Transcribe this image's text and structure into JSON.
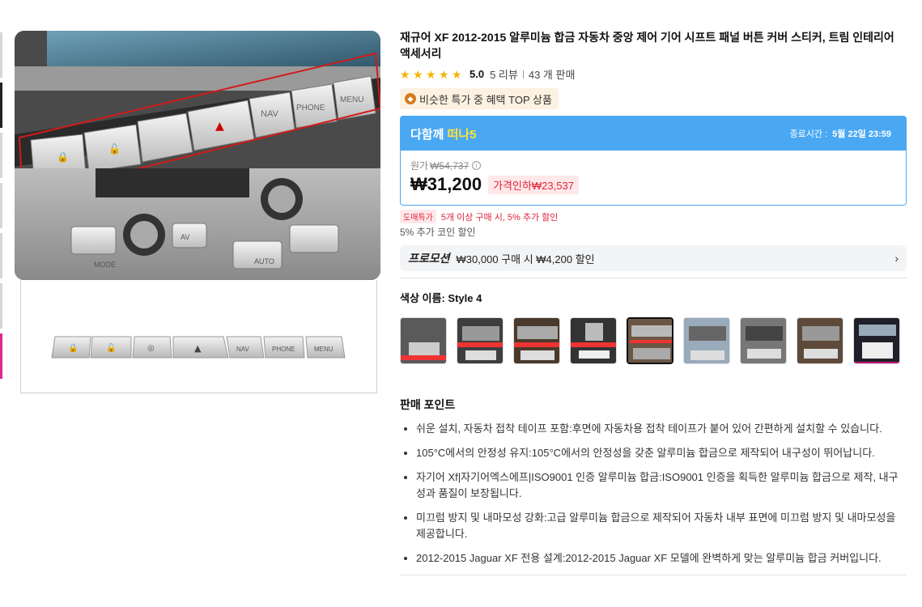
{
  "product": {
    "title": "재규어 XF 2012-2015 알루미늄 합금 자동차 중앙 제어 기어 시프트 패널 버튼 커버 스티커, 트림 인테리어 액세서리",
    "rating": "5.0",
    "reviews": "5 리뷰",
    "sold": "43 개 판매",
    "badge": "비슷한 특가 중 혜택 TOP 상품"
  },
  "deal": {
    "brand_a": "다함께 ",
    "brand_b": "떠나5",
    "ends_label": "종료시간 :",
    "ends_value": "5월 22일 23:59",
    "original_label": "원가",
    "original_price": "₩54,737",
    "price": "₩31,200",
    "drop": "가격인하₩23,537"
  },
  "wholesale": {
    "tag": "도매특가",
    "text": "5개 이상 구매 시, 5% 추가 할인",
    "coin": "5% 추가 코인 할인"
  },
  "promotion": {
    "label": "프로모션",
    "text": "₩30,000 구매 시 ₩4,200 할인"
  },
  "color": {
    "label": "색상 이름: Style 4"
  },
  "selling": {
    "title": "판매 포인트",
    "points": [
      "쉬운 설치, 자동차 접착 테이프 포함:후면에 자동차용 접착 테이프가 붙어 있어 간편하게 설치할 수 있습니다.",
      "105°C에서의 안정성 유지:105°C에서의 안정성을 갖춘 알루미늄 합금으로 제작되어 내구성이 뛰어납니다.",
      "자기어 Xf|자기어엑스에프|ISO9001 인증 알루미늄 합금:ISO9001 인증을 획득한 알루미늄 합금으로 제작, 내구성과 품질이 보장됩니다.",
      "미끄럼 방지 및 내마모성 강화:고급 알루미늄 합금으로 제작되어 자동차 내부 표면에 미끄럼 방지 및 내마모성을 제공합니다.",
      "2012-2015 Jaguar XF 전용 설계:2012-2015 Jaguar XF 모델에 완벽하게 맞는 알루미늄 합금 커버입니다."
    ]
  },
  "image_labels": {
    "nav": "NAV",
    "phone": "PHONE",
    "menu": "MENU",
    "mode": "MODE",
    "av": "AV",
    "auto": "AUTO"
  },
  "colors": {
    "accent_blue": "#4aa8f3",
    "price_red": "#e0253a",
    "star": "#f6b400"
  }
}
